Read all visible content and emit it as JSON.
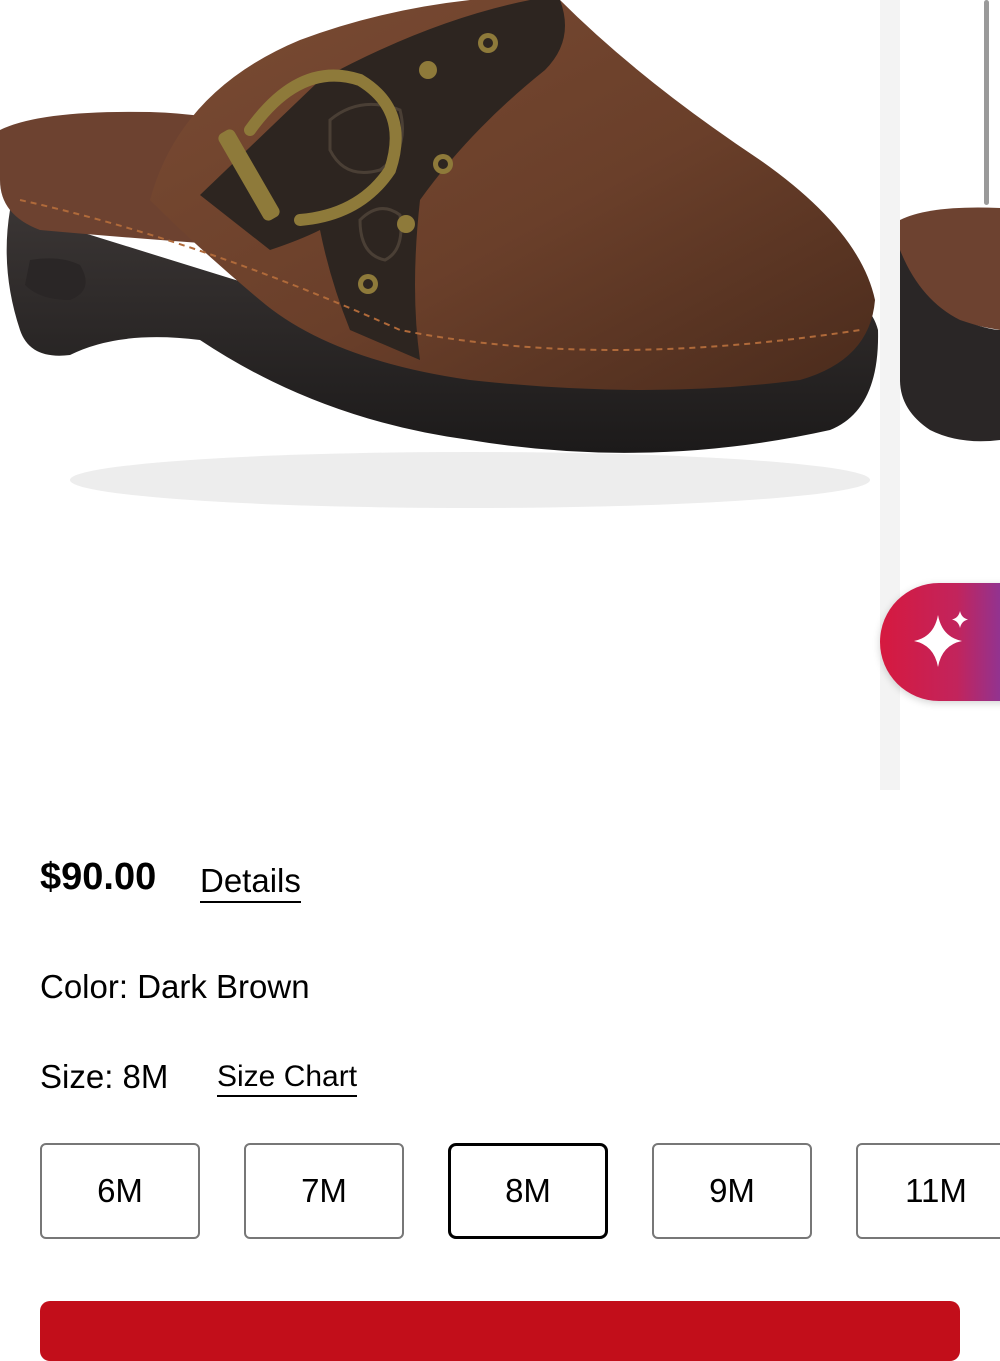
{
  "product": {
    "price": "$90.00",
    "details_label": "Details",
    "color_label": "Color:",
    "color_value": "Dark Brown",
    "size_label": "Size:",
    "size_value": "8M",
    "size_chart_label": "Size Chart"
  },
  "sizes": [
    "6M",
    "7M",
    "8M",
    "9M",
    "11M"
  ],
  "selected_size": "8M",
  "colors": {
    "accent_red": "#c20e1a",
    "ai_gradient_start": "#d6193f",
    "ai_gradient_end": "#7c3aa8"
  },
  "icons": {
    "ai_assistant": "sparkle-icon"
  }
}
